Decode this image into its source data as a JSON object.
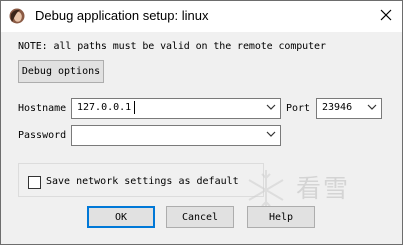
{
  "window": {
    "title": "Debug application setup: linux"
  },
  "note": "NOTE: all paths must be valid on the remote computer",
  "buttons": {
    "debug_options": "Debug options",
    "ok": "OK",
    "cancel": "Cancel",
    "help": "Help"
  },
  "fields": {
    "hostname_label": "Hostname",
    "hostname_value": "127.0.0.1",
    "port_label": "Port",
    "port_value": "23946",
    "password_label": "Password",
    "password_value": ""
  },
  "checkbox": {
    "label": "Save network settings as default",
    "checked": false
  },
  "watermark": {
    "text": "看雪"
  },
  "icons": {
    "app": "ida-woman-icon",
    "close": "close-icon",
    "dropdown": "chevron-down-icon",
    "watermark": "snowflake-icon"
  }
}
